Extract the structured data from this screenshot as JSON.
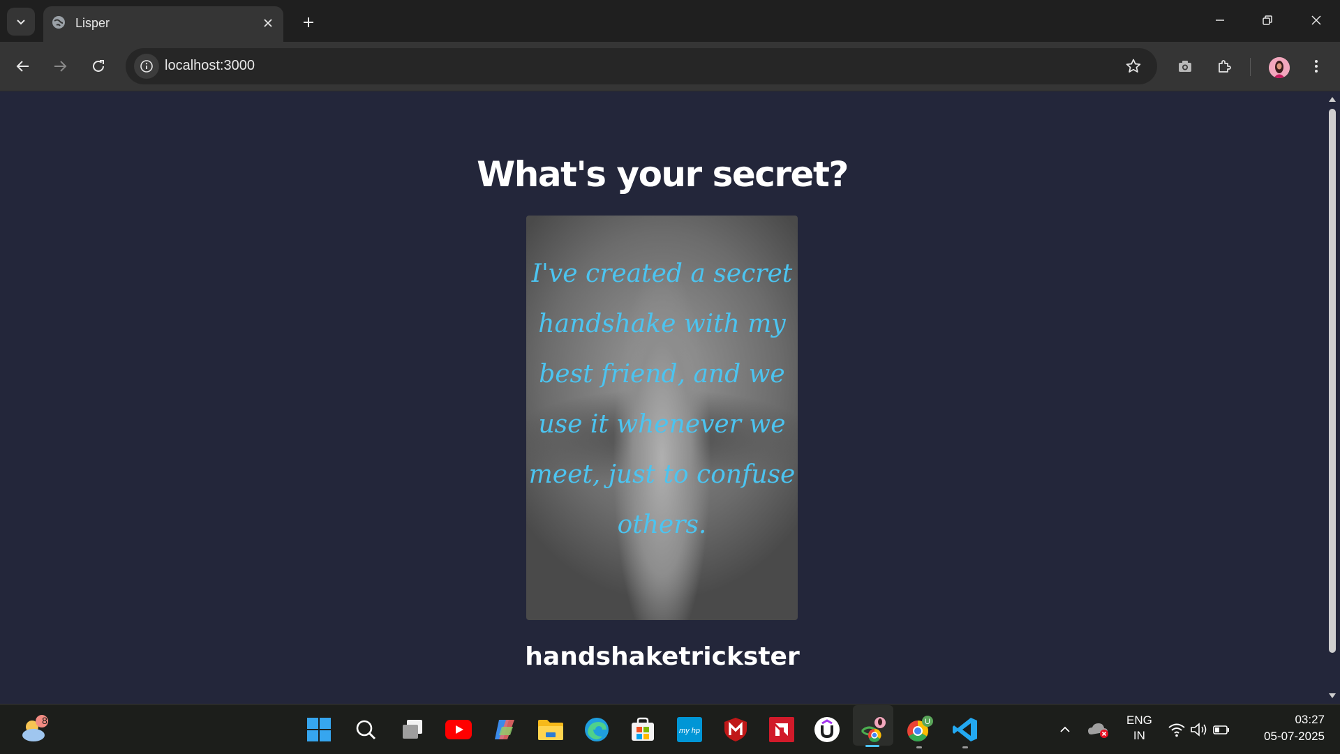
{
  "browser": {
    "tab": {
      "title": "Lisper"
    },
    "address_bar": {
      "url": "localhost:3000"
    }
  },
  "page": {
    "heading": "What's your secret?",
    "secret": "I've created a secret handshake with my best friend, and we use it whenever we meet, just to confuse others.",
    "username": "handshaketrickster"
  },
  "taskbar": {
    "weather_badge": "8",
    "language_line1": "ENG",
    "language_line2": "IN",
    "time": "03:27",
    "date": "05-07-2025"
  },
  "colors": {
    "page_bg": "#23263a",
    "secret_text": "#4cc4f0",
    "heading_text": "#ffffff"
  }
}
